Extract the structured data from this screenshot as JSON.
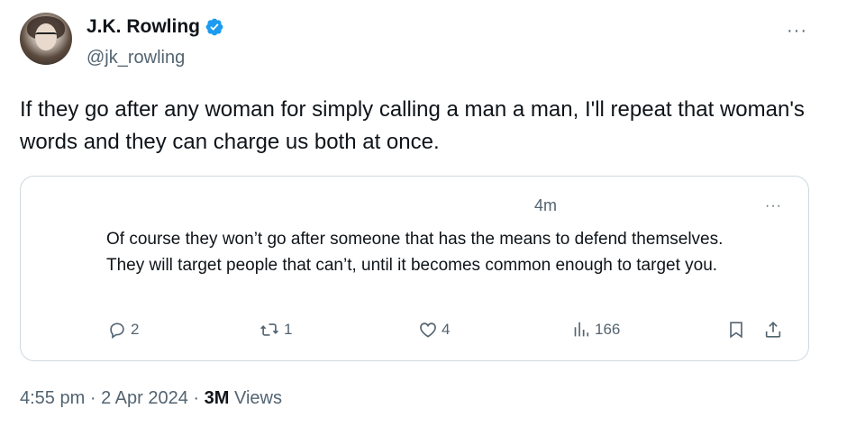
{
  "author": {
    "display_name": "J.K. Rowling",
    "handle": "@jk_rowling"
  },
  "tweet": {
    "text": "If they go after any woman for simply calling a man a man, I'll repeat that woman's words and they can charge us both at once.",
    "more_label": "···"
  },
  "quoted": {
    "time": "4m",
    "text": "Of course they won’t go after someone that has the means to defend themselves. They will target people that can’t, until it becomes common enough to target you.",
    "more_label": "···",
    "replies": "2",
    "reposts": "1",
    "likes": "4",
    "views": "166"
  },
  "footer": {
    "time": "4:55 pm",
    "separator": "·",
    "date": "2 Apr 2024",
    "views_count": "3M",
    "views_label": "Views"
  },
  "colors": {
    "verified": "#1d9bf0",
    "secondary_text": "#536471",
    "border": "#cfd9de"
  },
  "icons": [
    "verified-badge-icon",
    "more-icon",
    "reply-icon",
    "repost-icon",
    "like-icon",
    "views-icon",
    "bookmark-icon",
    "share-icon"
  ]
}
